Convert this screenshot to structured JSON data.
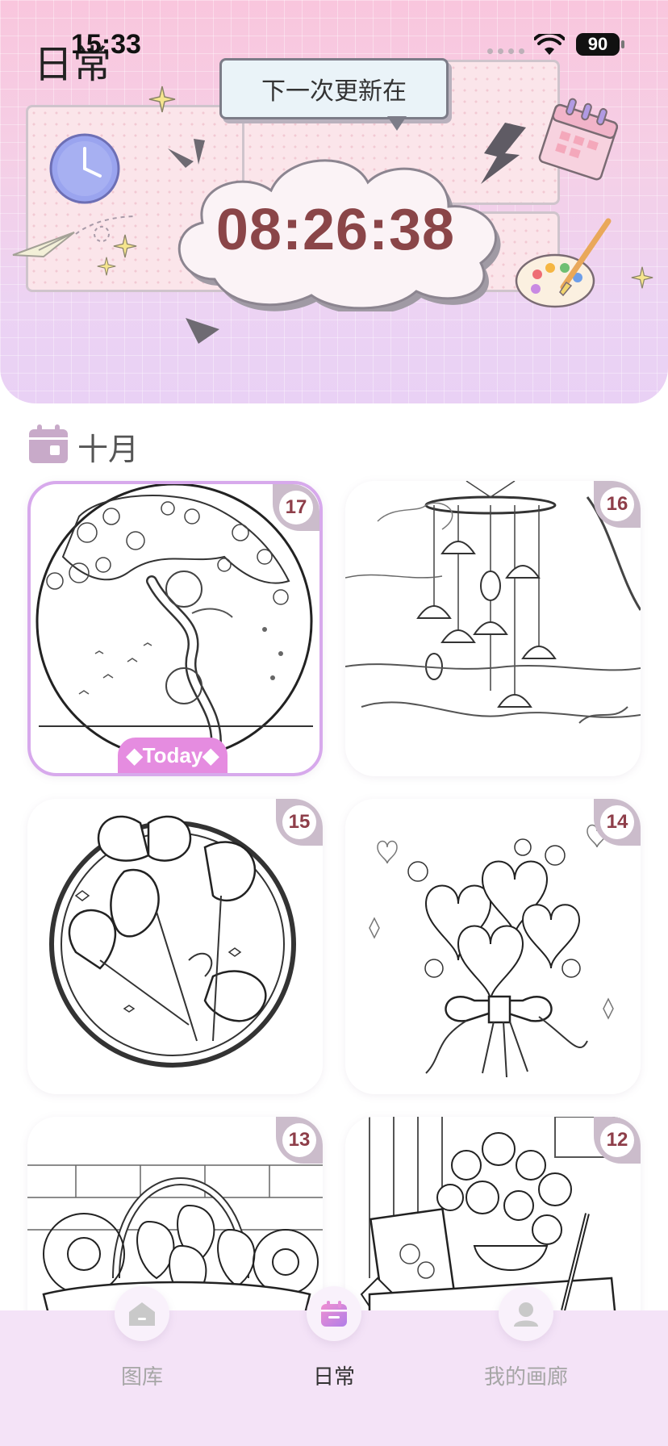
{
  "status_bar": {
    "time": "15:33",
    "battery": "90"
  },
  "header": {
    "title": "日常",
    "next_update_label": "下一次更新在",
    "countdown": "08:26:38"
  },
  "month": {
    "label": "十月"
  },
  "cards": [
    {
      "day": "17",
      "today": true,
      "today_label": "Today"
    },
    {
      "day": "16",
      "today": false
    },
    {
      "day": "15",
      "today": false
    },
    {
      "day": "14",
      "today": false
    },
    {
      "day": "13",
      "today": false
    },
    {
      "day": "12",
      "today": false
    }
  ],
  "tabbar": {
    "items": [
      {
        "label": "图库",
        "icon": "home-icon",
        "active": false
      },
      {
        "label": "日常",
        "icon": "calendar-icon",
        "active": true
      },
      {
        "label": "我的画廊",
        "icon": "profile-icon",
        "active": false
      }
    ]
  },
  "colors": {
    "accent": "#e58ce0",
    "badge_text": "#8e3e49",
    "countdown": "#8a4548"
  }
}
